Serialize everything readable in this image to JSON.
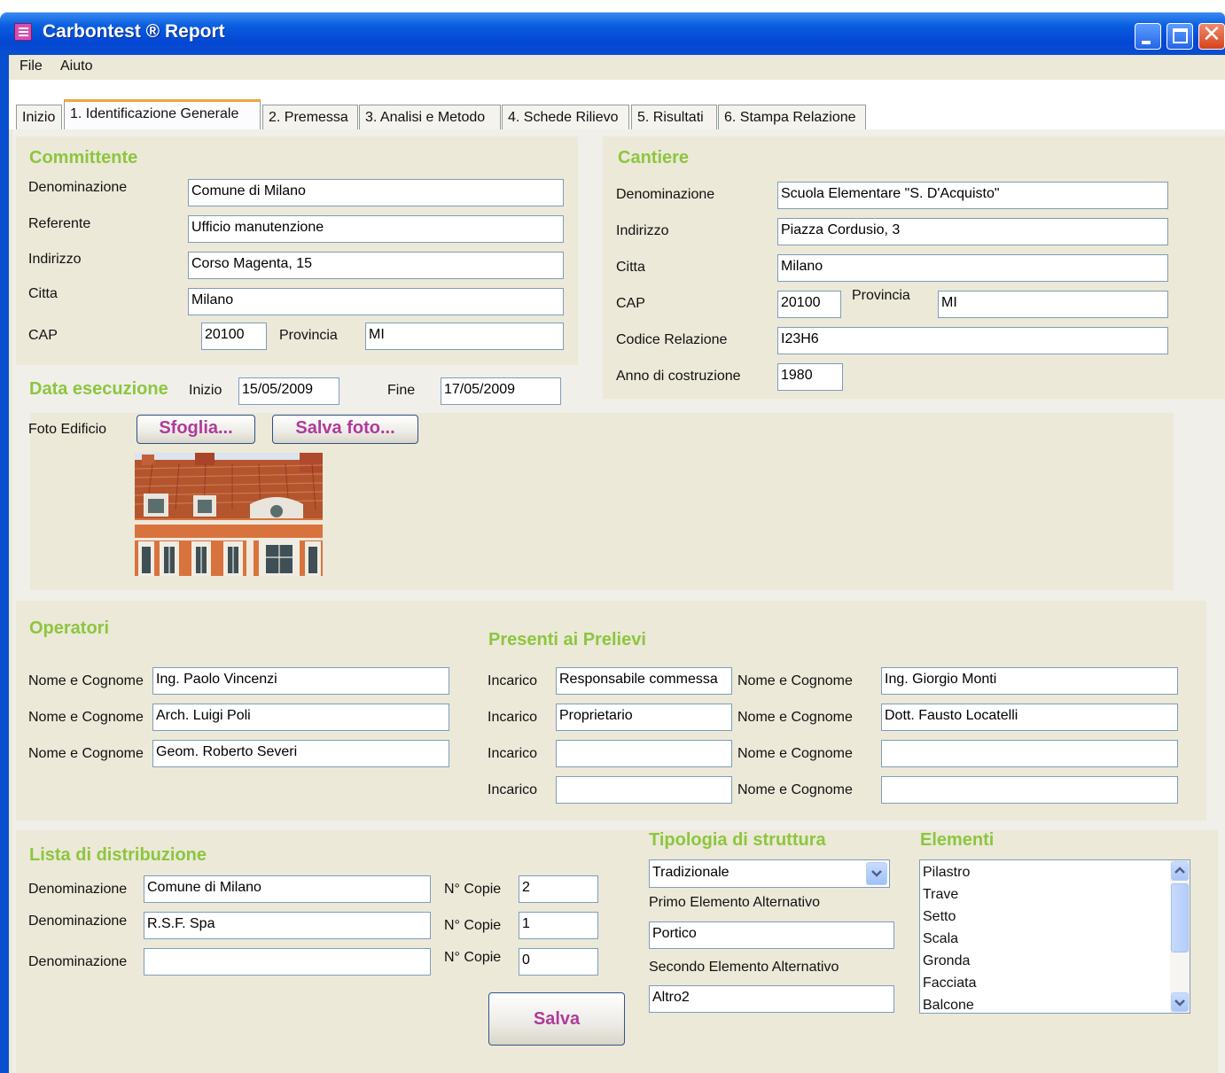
{
  "window": {
    "title": "Carbontest ® Report",
    "menu": [
      "File",
      "Aiuto"
    ]
  },
  "tabs": [
    "Inizio",
    "1. Identificazione Generale",
    "2. Premessa",
    "3. Analisi e Metodo",
    "4. Schede Rilievo",
    "5. Risultati",
    "6. Stampa Relazione"
  ],
  "active_tab": "1. Identificazione Generale",
  "committente": {
    "title": "Committente",
    "denominazione_label": "Denominazione",
    "denominazione": "Comune di Milano",
    "referente_label": "Referente",
    "referente": "Ufficio manutenzione",
    "indirizzo_label": "Indirizzo",
    "indirizzo": "Corso Magenta, 15",
    "citta_label": "Citta",
    "citta": "Milano",
    "cap_label": "CAP",
    "cap": "20100",
    "provincia_label": "Provincia",
    "provincia": "MI"
  },
  "cantiere": {
    "title": "Cantiere",
    "denominazione_label": "Denominazione",
    "denominazione": "Scuola Elementare \"S. D'Acquisto\"",
    "indirizzo_label": "Indirizzo",
    "indirizzo": "Piazza Cordusio, 3",
    "citta_label": "Citta",
    "citta": "Milano",
    "cap_label": "CAP",
    "cap": "20100",
    "provincia_label": "Provincia",
    "provincia": "MI",
    "codice_label": "Codice Relazione",
    "codice": "I23H6",
    "anno_label": "Anno di costruzione",
    "anno": "1980"
  },
  "data_esecuzione": {
    "title": "Data esecuzione",
    "inizio_label": "Inizio",
    "inizio": "15/05/2009",
    "fine_label": "Fine",
    "fine": "17/05/2009"
  },
  "foto": {
    "label": "Foto Edificio",
    "browse_button": "Sfoglia...",
    "save_button": "Salva foto..."
  },
  "operatori": {
    "title": "Operatori",
    "label": "Nome e Cognome",
    "names": [
      "Ing. Paolo Vincenzi",
      "Arch. Luigi Poli",
      "Geom. Roberto Severi"
    ]
  },
  "presenti": {
    "title": "Presenti ai Prelievi",
    "incarico_label": "Incarico",
    "nome_label": "Nome e Cognome",
    "rows": [
      {
        "incarico": "Responsabile commessa",
        "nome": "Ing. Giorgio Monti"
      },
      {
        "incarico": "Proprietario",
        "nome": "Dott. Fausto Locatelli"
      },
      {
        "incarico": "",
        "nome": ""
      },
      {
        "incarico": "",
        "nome": ""
      }
    ]
  },
  "distribuzione": {
    "title": "Lista di distribuzione",
    "denominazione_label": "Denominazione",
    "copie_label": "N° Copie",
    "rows": [
      {
        "denominazione": "Comune di Milano",
        "copie": "2"
      },
      {
        "denominazione": "R.S.F. Spa",
        "copie": "1"
      },
      {
        "denominazione": "",
        "copie": "0"
      }
    ],
    "save_button": "Salva"
  },
  "tipologia": {
    "title": "Tipologia di struttura",
    "selected": "Tradizionale",
    "primo_label": "Primo Elemento Alternativo",
    "primo": "Portico",
    "secondo_label": "Secondo Elemento Alternativo",
    "secondo": "Altro2"
  },
  "elementi": {
    "title": "Elementi",
    "items": [
      "Pilastro",
      "Trave",
      "Setto",
      "Scala",
      "Gronda",
      "Facciata",
      "Balcone"
    ]
  }
}
